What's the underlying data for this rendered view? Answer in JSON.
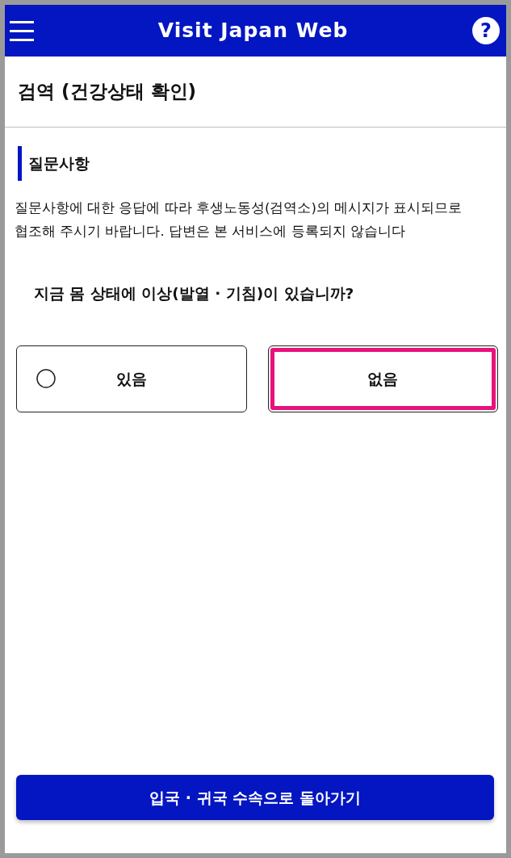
{
  "header": {
    "title": "Visit Japan Web",
    "help_label": "?"
  },
  "page_title": "검역 (건강상태 확인)",
  "section": {
    "heading": "질문사항",
    "description": "질문사항에 대한 응답에 따라 후생노동성(검역소)의 메시지가 표시되므로 협조해 주시기 바랍니다. 답변은 본 서비스에 등록되지 않습니다"
  },
  "question": {
    "text": "지금 몸 상태에 이상(발열 · 기침)이 있습니까?",
    "options": [
      {
        "label": "있음",
        "selected": false,
        "highlighted": false
      },
      {
        "label": "없음",
        "selected": false,
        "highlighted": true
      }
    ]
  },
  "footer_button": "입국 · 귀국 수속으로 돌아가기"
}
